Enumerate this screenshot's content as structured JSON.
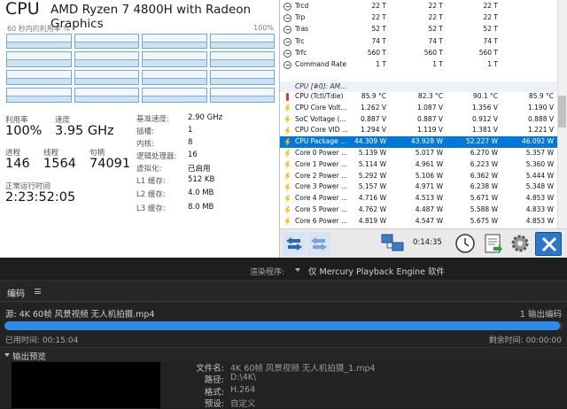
{
  "task_manager": {
    "title": "CPU",
    "model": "AMD Ryzen 7 4800H with Radeon Graphics",
    "graph_left_label": "60 秒内的利用率 %",
    "graph_right_label": "100%",
    "stats": {
      "util_label": "利用率",
      "util_value": "100%",
      "speed_label": "速度",
      "speed_value": "3.95 GHz",
      "proc_label": "进程",
      "proc_value": "146",
      "threads_label": "线程",
      "threads_value": "1564",
      "handles_label": "句柄",
      "handles_value": "74091",
      "uptime_label": "正常运行时间",
      "uptime_value": "2:23:52:05"
    },
    "specs": [
      {
        "label": "基准速度:",
        "value": "2.90 GHz"
      },
      {
        "label": "插槽:",
        "value": "1"
      },
      {
        "label": "内核:",
        "value": "8"
      },
      {
        "label": "逻辑处理器:",
        "value": "16"
      },
      {
        "label": "虚拟化:",
        "value": "已启用"
      },
      {
        "label": "L1 缓存:",
        "value": "512 KB"
      },
      {
        "label": "L2 缓存:",
        "value": "4.0 MB"
      },
      {
        "label": "L3 缓存:",
        "value": "8.0 MB"
      }
    ]
  },
  "hwinfo": {
    "timing_rows": [
      {
        "name": "Trcd",
        "icon": "circle-icon",
        "v": [
          "22 T",
          "22 T",
          "22 T",
          ""
        ]
      },
      {
        "name": "Trp",
        "icon": "circle-icon",
        "v": [
          "22 T",
          "22 T",
          "22 T",
          ""
        ]
      },
      {
        "name": "Tras",
        "icon": "circle-icon",
        "v": [
          "52 T",
          "52 T",
          "52 T",
          ""
        ]
      },
      {
        "name": "Trc",
        "icon": "circle-icon",
        "v": [
          "74 T",
          "74 T",
          "74 T",
          ""
        ]
      },
      {
        "name": "Trfc",
        "icon": "circle-icon",
        "v": [
          "560 T",
          "560 T",
          "560 T",
          ""
        ]
      },
      {
        "name": "Command Rate",
        "icon": "circle-icon",
        "v": [
          "1 T",
          "1 T",
          "1 T",
          ""
        ]
      }
    ],
    "section": "CPU [#0]: AM...",
    "sensor_rows": [
      {
        "name": "CPU (Tctl/Tdie)",
        "icon": "thermometer-icon",
        "v": [
          "85.9 °C",
          "82.3 °C",
          "90.1 °C",
          "85.9 °C"
        ]
      },
      {
        "name": "CPU Core Volt...",
        "icon": "bolt-icon",
        "v": [
          "1.262 V",
          "1.087 V",
          "1.356 V",
          "1.190 V"
        ]
      },
      {
        "name": "SoC Voltage (...",
        "icon": "bolt-icon",
        "v": [
          "0.887 V",
          "0.887 V",
          "0.912 V",
          "0.888 V"
        ]
      },
      {
        "name": "CPU Core VID ...",
        "icon": "bolt-icon",
        "v": [
          "1.294 V",
          "1.119 V",
          "1.381 V",
          "1.221 V"
        ]
      },
      {
        "name": "CPU Package ...",
        "icon": "bolt-icon",
        "v": [
          "44.309 W",
          "43.928 W",
          "52.227 W",
          "46.092 W"
        ],
        "selected": true
      },
      {
        "name": "Core 0 Power ...",
        "icon": "bolt-icon",
        "v": [
          "5.139 W",
          "5.017 W",
          "6.270 W",
          "5.357 W"
        ]
      },
      {
        "name": "Core 1 Power ...",
        "icon": "bolt-icon",
        "v": [
          "5.114 W",
          "4.961 W",
          "6.223 W",
          "5.360 W"
        ]
      },
      {
        "name": "Core 2 Power ...",
        "icon": "bolt-icon",
        "v": [
          "5.292 W",
          "5.106 W",
          "6.362 W",
          "5.444 W"
        ]
      },
      {
        "name": "Core 3 Power ...",
        "icon": "bolt-icon",
        "v": [
          "5.157 W",
          "4.971 W",
          "6.238 W",
          "5.348 W"
        ]
      },
      {
        "name": "Core 4 Power ...",
        "icon": "bolt-icon",
        "v": [
          "4.716 W",
          "4.513 W",
          "5.671 W",
          "4.853 W"
        ]
      },
      {
        "name": "Core 5 Power ...",
        "icon": "bolt-icon",
        "v": [
          "4.762 W",
          "4.487 W",
          "5.588 W",
          "4.833 W"
        ]
      },
      {
        "name": "Core 6 Power ...",
        "icon": "bolt-icon",
        "v": [
          "4.819 W",
          "4.547 W",
          "5.675 W",
          "4.853 W"
        ]
      }
    ],
    "toolbar_time": "0:14:35"
  },
  "encoder": {
    "renderer_label": "渲染程序:",
    "renderer_value": "仅 Mercury Playback Engine 软件",
    "tab": "编码",
    "source": "源: 4K 60帧 风景视频 无人机拍摄.mp4",
    "output_count": "1 输出编码",
    "progress_fraction": 0.995,
    "elapsed": "已用时间: 00:15:04",
    "remaining": "剩余时间: 00:00:00",
    "preview_title": "输出预览",
    "details": [
      {
        "k": "文件名:",
        "v": "4K 60帧 风景视频 无人机拍摄_1.mp4"
      },
      {
        "k": "路径:",
        "v": "D:\\4K\\"
      },
      {
        "k": "格式:",
        "v": "H.264"
      },
      {
        "k": "预设:",
        "v": "自定义"
      }
    ],
    "accent": "#2d8ceb"
  }
}
